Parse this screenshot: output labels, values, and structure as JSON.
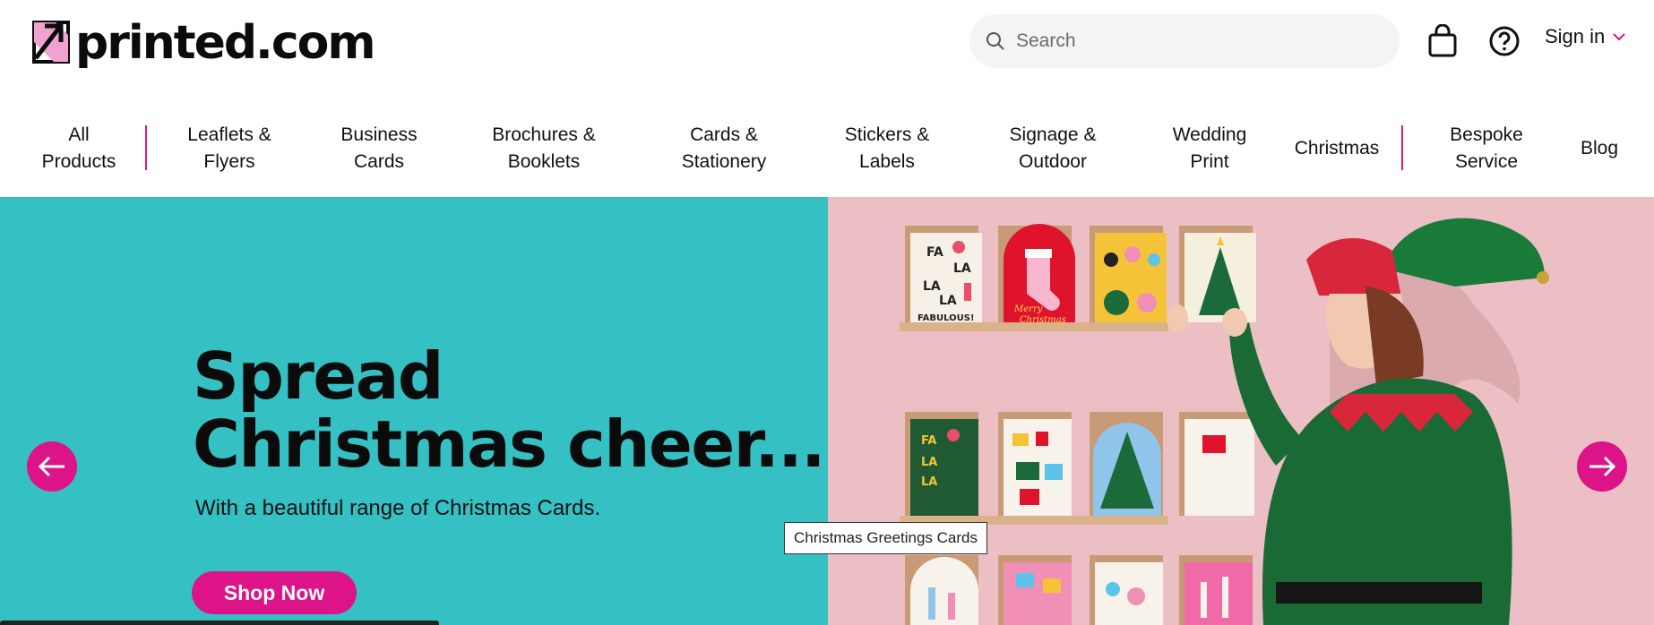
{
  "header": {
    "logo_text": "printed.com",
    "search_placeholder": "Search",
    "sign_in_label": "Sign in"
  },
  "nav": {
    "items": [
      {
        "line1": "All",
        "line2": "Products"
      },
      {
        "line1": "Leaflets &",
        "line2": "Flyers"
      },
      {
        "line1": "Business",
        "line2": "Cards"
      },
      {
        "line1": "Brochures &",
        "line2": "Booklets"
      },
      {
        "line1": "Cards &",
        "line2": "Stationery"
      },
      {
        "line1": "Stickers &",
        "line2": "Labels"
      },
      {
        "line1": "Signage &",
        "line2": "Outdoor"
      },
      {
        "line1": "Wedding",
        "line2": "Print"
      },
      {
        "line1": "Christmas",
        "line2": ""
      },
      {
        "line1": "Bespoke",
        "line2": "Service"
      },
      {
        "line1": "Blog",
        "line2": ""
      }
    ]
  },
  "hero": {
    "title_line1": "Spread",
    "title_line2": "Christmas cheer...",
    "subtitle": "With a beautiful range of Christmas Cards.",
    "cta_label": "Shop Now",
    "tooltip": "Christmas Greetings Cards",
    "card_texts": {
      "fa": "FA",
      "la": "LA",
      "fabulous": "FABULOUS!",
      "merry": "Merry",
      "christmas": "Christmas"
    }
  },
  "colors": {
    "brand_pink": "#dd1388",
    "hero_teal": "#35c1c4",
    "hero_pink": "#ebbfc3"
  },
  "icons": [
    "logo-mark-icon",
    "search-icon",
    "shopping-bag-icon",
    "help-icon",
    "chevron-down-icon",
    "arrow-left-icon",
    "arrow-right-icon"
  ]
}
